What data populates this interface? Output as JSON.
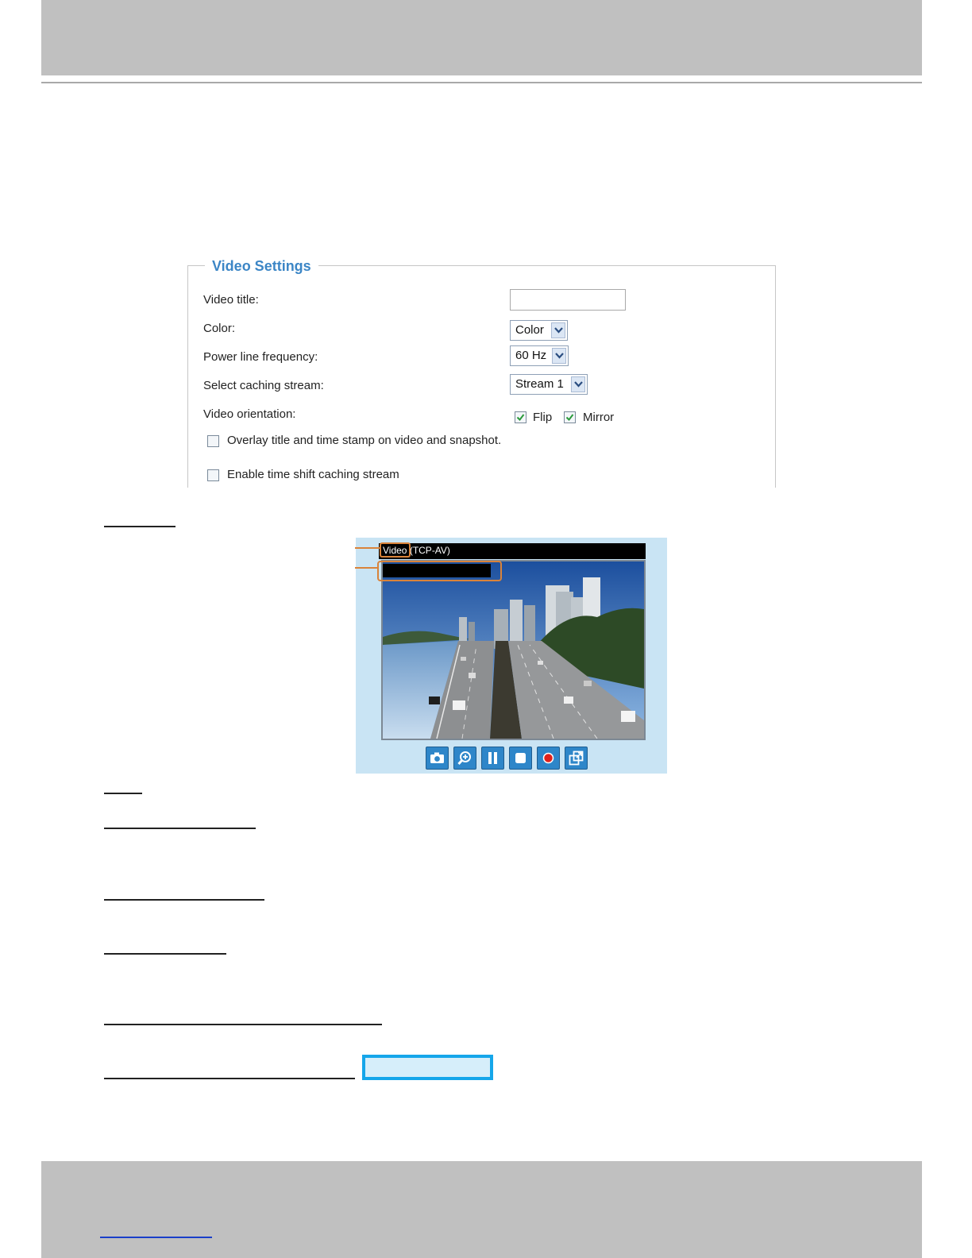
{
  "video_settings": {
    "legend": "Video Settings",
    "video_title_label": "Video title:",
    "video_title_value": "",
    "color_label": "Color:",
    "color_value": "Color",
    "power_label": "Power line frequency:",
    "power_value": "60 Hz",
    "caching_label": "Select caching stream:",
    "caching_value": "Stream 1",
    "orientation_label": "Video orientation:",
    "flip_label": "Flip",
    "flip_checked": true,
    "mirror_label": "Mirror",
    "mirror_checked": true,
    "overlay_label": "Overlay title and time stamp on video and snapshot.",
    "overlay_checked": false,
    "timeshift_label": "Enable time shift caching stream",
    "timeshift_checked": false
  },
  "viewer": {
    "title_word": "Video",
    "title_suffix": " (TCP-AV)",
    "controls": [
      "camera-icon",
      "zoom-icon",
      "pause-icon",
      "stop-icon",
      "record-icon",
      "fullscreen-icon"
    ]
  },
  "colors": {
    "legend_blue": "#3c86c6",
    "callout_orange": "#d9833a",
    "viewer_bg": "#c9e4f4",
    "button_blue": "#2e86c9",
    "record_red": "#e0201b",
    "highlight_blue": "#15a6ea"
  }
}
